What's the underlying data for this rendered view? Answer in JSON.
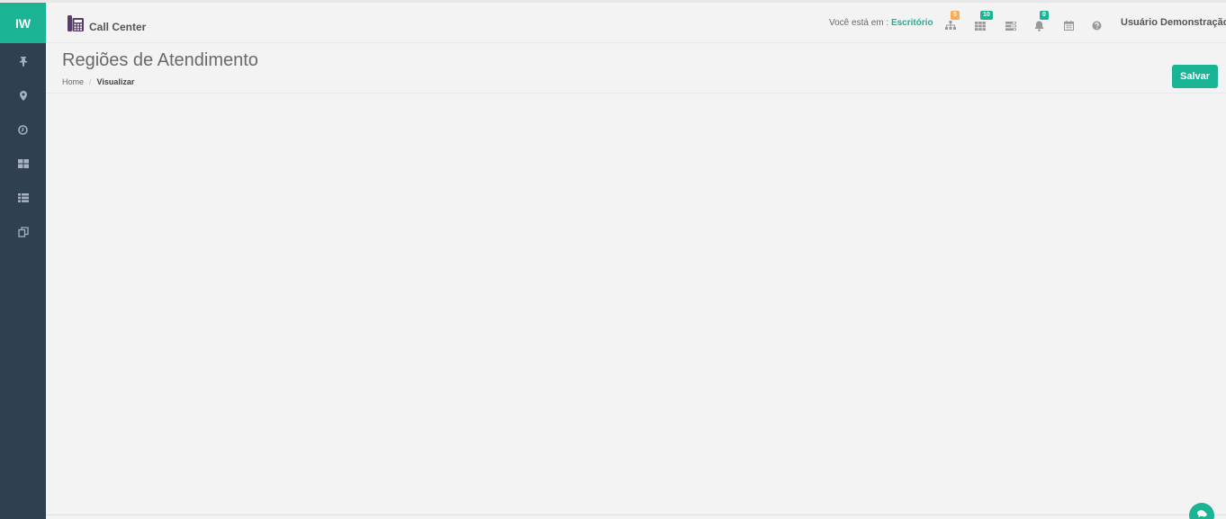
{
  "app": {
    "logo": "IW"
  },
  "header": {
    "brand_label": "Call Center",
    "location_prefix": "Você está em :",
    "location": "Escritório",
    "badges": {
      "hierarchy": "5",
      "grid": "10",
      "bell": "0"
    },
    "user_name": "Usuário Demonstração"
  },
  "page": {
    "title": "Regiões de Atendimento",
    "breadcrumb": {
      "home": "Home",
      "separator": "/",
      "current": "Visualizar"
    },
    "save_label": "Salvar"
  },
  "sidebar": {
    "items": [
      {
        "icon": "pin-icon"
      },
      {
        "icon": "map-marker-icon"
      },
      {
        "icon": "clock-icon"
      },
      {
        "icon": "grid-icon"
      },
      {
        "icon": "list-icon"
      },
      {
        "icon": "copy-icon"
      }
    ]
  },
  "colors": {
    "accent": "#1ab394",
    "sidebar": "#2f4050",
    "background": "#f3f3f3",
    "badge_orange": "#f8ac59"
  }
}
